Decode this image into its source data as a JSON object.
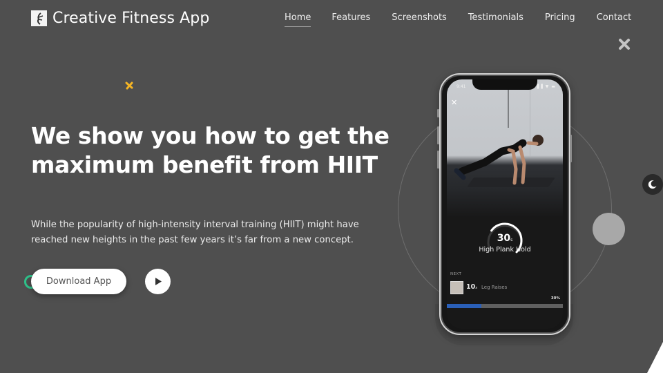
{
  "brand": {
    "name": "Creative Fitness App",
    "logo_icon": "fitness-logo-icon"
  },
  "nav": {
    "items": [
      {
        "label": "Home",
        "active": true
      },
      {
        "label": "Features",
        "active": false
      },
      {
        "label": "Screenshots",
        "active": false
      },
      {
        "label": "Testimonials",
        "active": false
      },
      {
        "label": "Pricing",
        "active": false
      },
      {
        "label": "Contact",
        "active": false
      }
    ]
  },
  "hero": {
    "title": "We show you how to get the maximum benefit from HIIT",
    "description": "While the popularity of high-intensity interval training (HIIT) might have reached new heights in the past few years it’s far from a new concept.",
    "download_label": "Download App",
    "play_icon": "play-icon"
  },
  "phone": {
    "status_time": "9:41",
    "status_icons": "▐▐ ▼ ▬",
    "close_icon": "✕",
    "timer_value": "30",
    "timer_unit": "s",
    "timer_fraction": 0.7,
    "exercise": "High Plank Hold",
    "next_label": "NEXT",
    "next_reps": "10",
    "next_reps_unit": "x",
    "next_exercise": "Leg Raises",
    "progress_label": "30%",
    "progress_fraction": 0.3
  },
  "colors": {
    "background": "#4f4f4f",
    "accent_green": "#2ec28a",
    "accent_yellow": "#f5b524",
    "progress_blue": "#2a5fb8",
    "dark_toggle": "#2a2a2a"
  },
  "icons": {
    "decor_star": "sparkle-icon",
    "close": "close-icon",
    "theme_toggle": "moon-icon"
  }
}
